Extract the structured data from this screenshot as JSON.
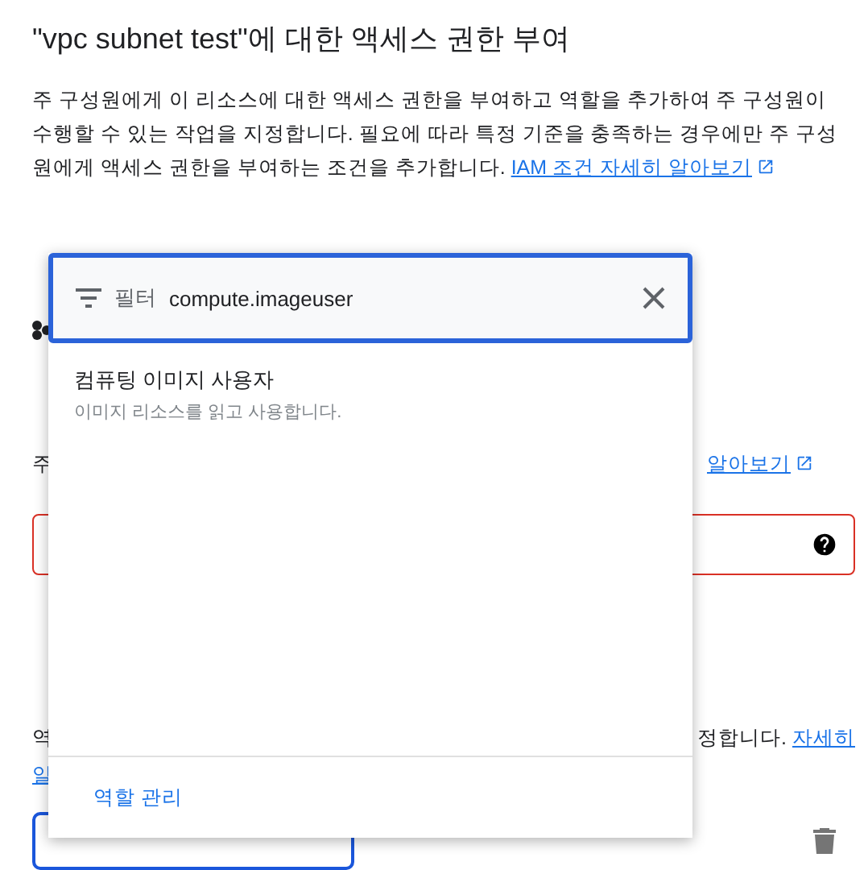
{
  "dialog": {
    "title": "\"vpc subnet test\"에 대한 액세스 권한 부여",
    "description": "주 구성원에게 이 리소스에 대한 액세스 권한을 부여하고 역할을 추가하여 주 구성원이 수행할 수 있는 작업을 지정합니다. 필요에 따라 특정 기준을 충족하는 경우에만 주 구성원에게 액세스 권한을 부여하는 조건을 추가합니다.",
    "description_link": "IAM 조건 자세히 알아보기",
    "principals_text": "주",
    "principals_link": "알아보기",
    "principals_field_error": true,
    "roles_text_left": "역",
    "roles_text_right": "정합니다.",
    "roles_link": "자세히",
    "roles_link_2": "알"
  },
  "role_dropdown": {
    "filter_label": "필터",
    "filter_value": "compute.imageuser",
    "options": [
      {
        "title": "컴퓨팅 이미지 사용자",
        "description": "이미지 리소스를 읽고 사용합니다."
      }
    ],
    "footer_link": "역할 관리"
  }
}
